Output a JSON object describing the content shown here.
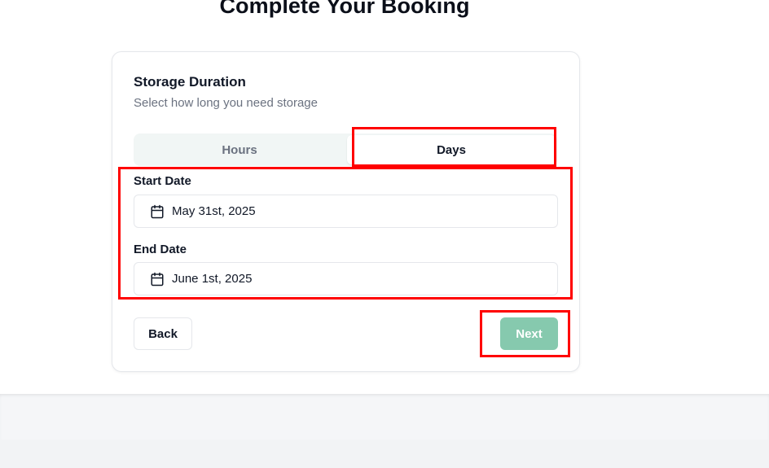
{
  "page": {
    "title": "Complete Your Booking"
  },
  "card": {
    "title": "Storage Duration",
    "subtitle": "Select how long you need storage",
    "tabs": [
      {
        "label": "Hours",
        "selected": false
      },
      {
        "label": "Days",
        "selected": true
      }
    ],
    "start_date": {
      "label": "Start Date",
      "value": "May 31st, 2025",
      "icon": "calendar-icon"
    },
    "end_date": {
      "label": "End Date",
      "value": "June 1st, 2025",
      "icon": "calendar-icon"
    },
    "back_label": "Back",
    "next_label": "Next"
  },
  "colors": {
    "accent": "#86c9ae",
    "highlight": "#ff0000",
    "tab_track": "#f1f6f5"
  }
}
